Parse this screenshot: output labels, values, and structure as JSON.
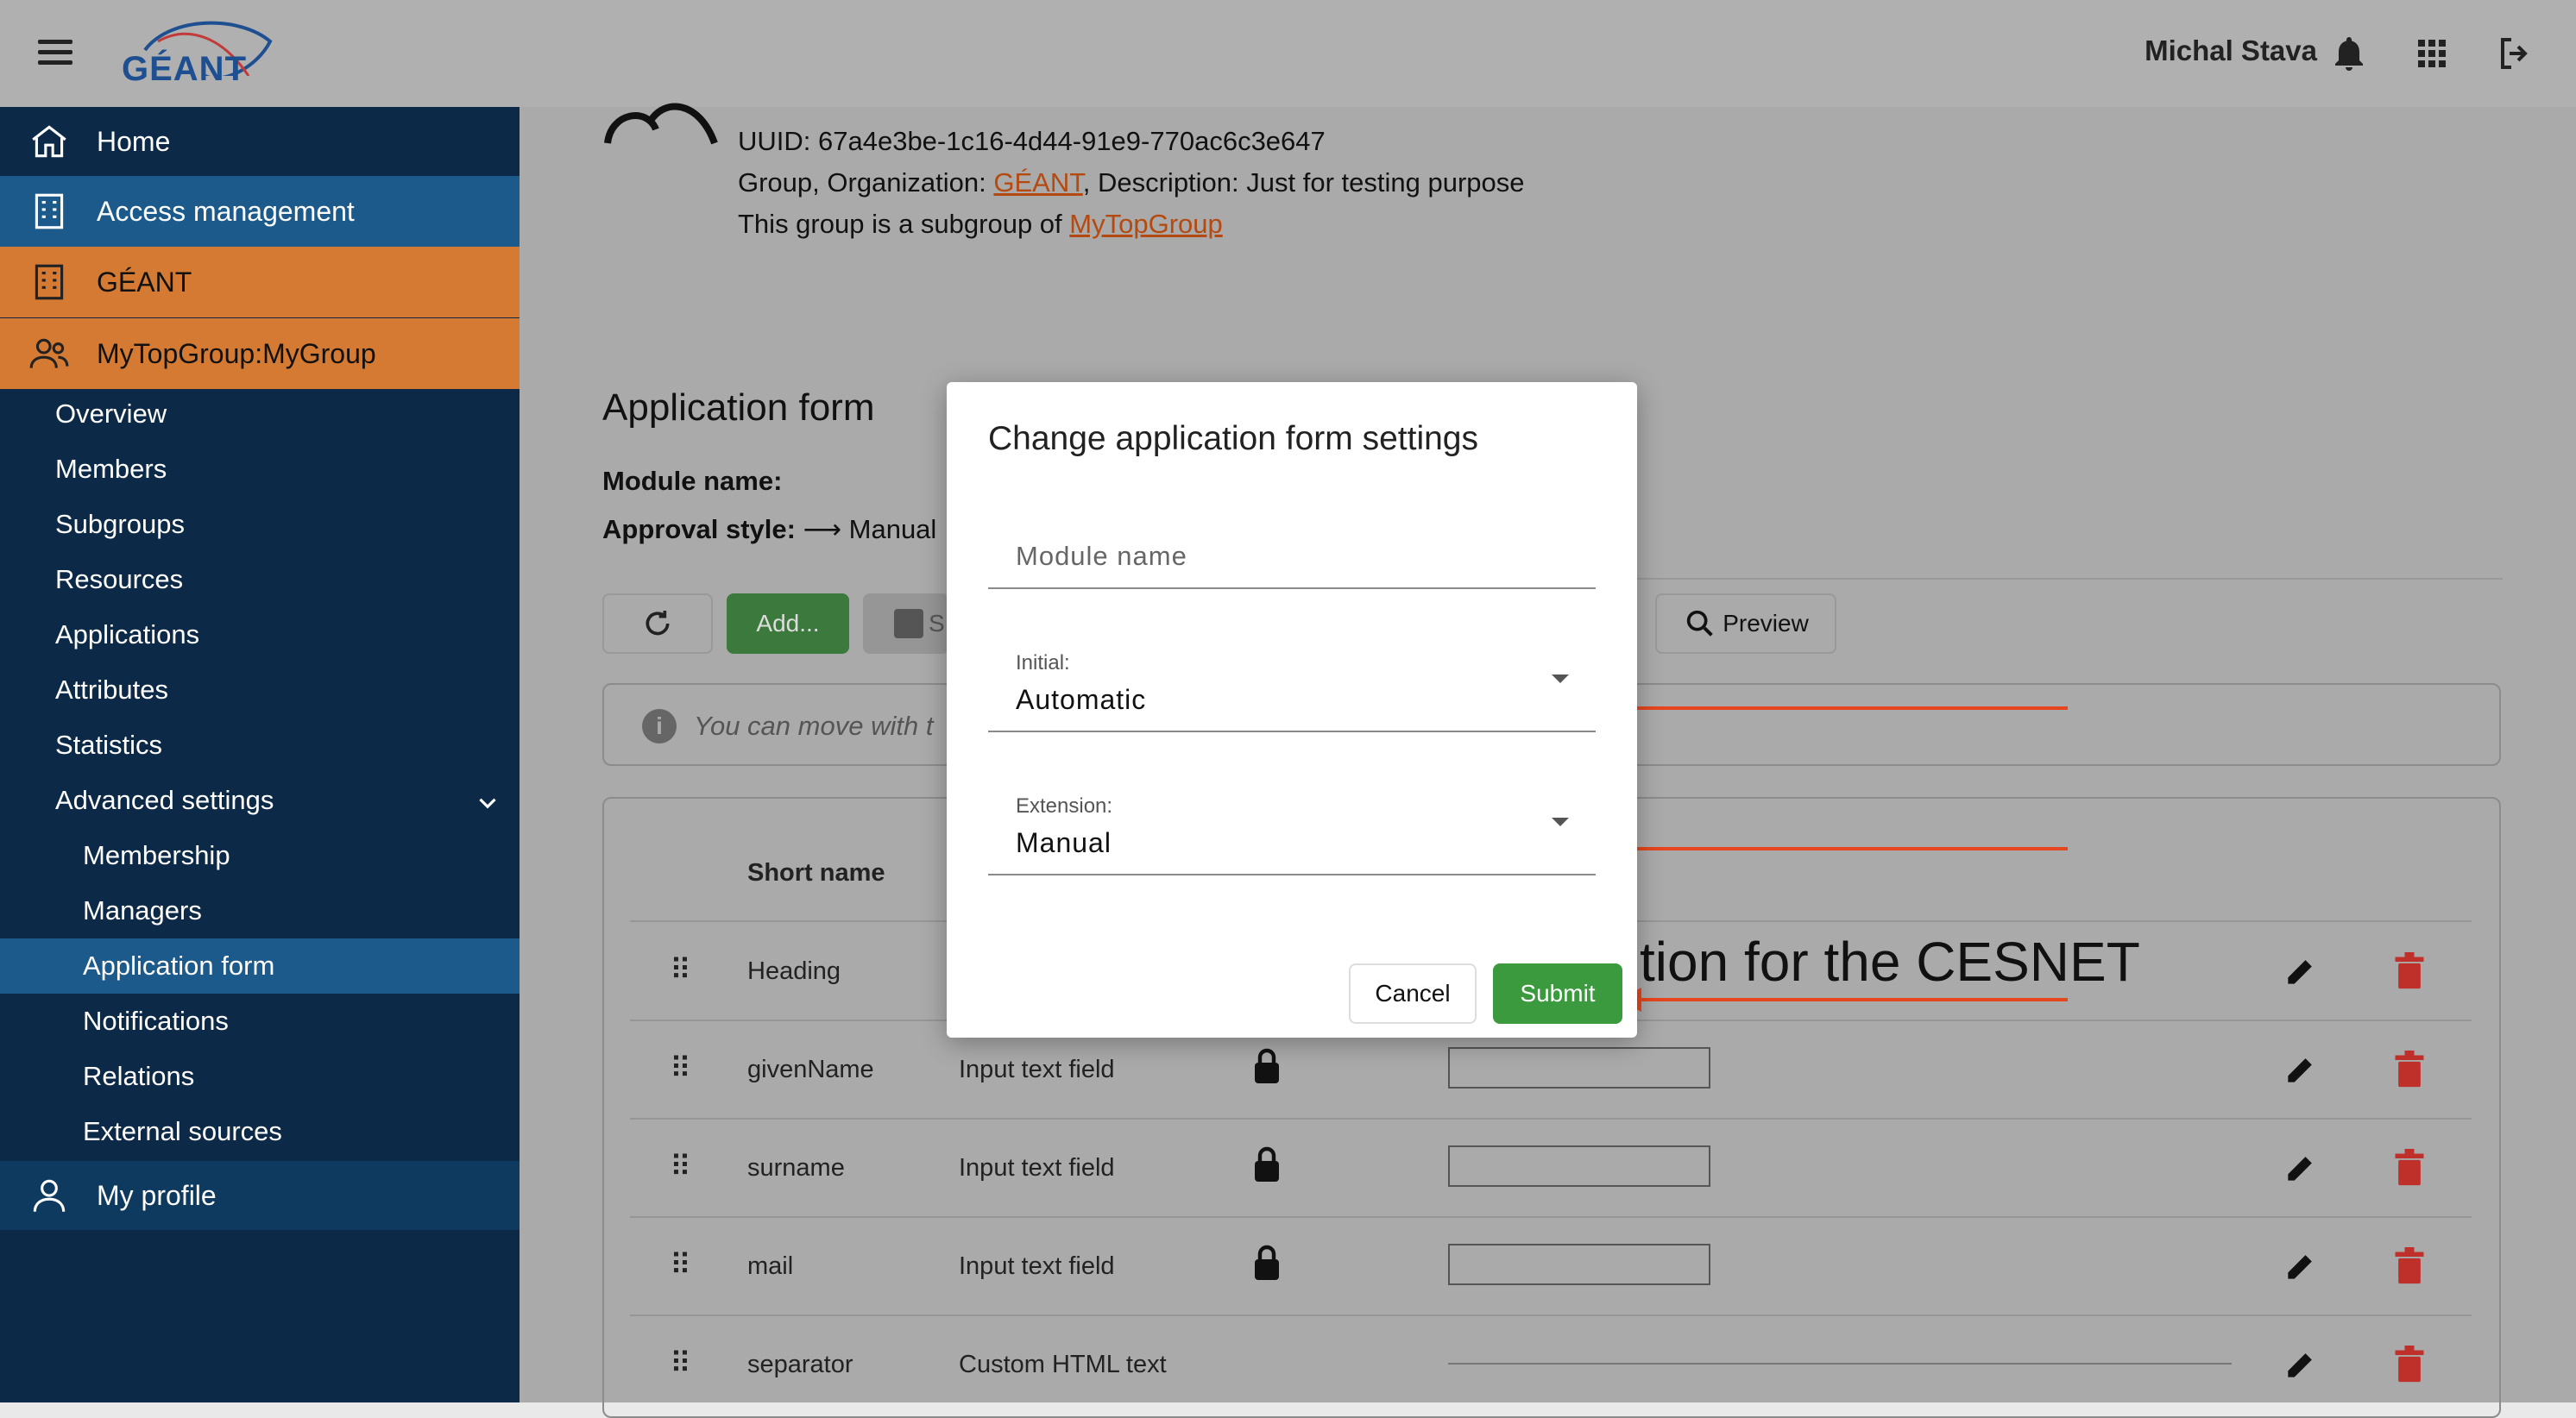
{
  "header": {
    "logo_text": "GÉANT",
    "user_name": "Michal Stava"
  },
  "sidebar": {
    "items": [
      {
        "label": "Home",
        "icon": "home-icon"
      },
      {
        "label": "Access management",
        "icon": "building-icon"
      },
      {
        "label": "GÉANT",
        "icon": "building-icon"
      },
      {
        "label": "MyTopGroup:MyGroup",
        "icon": "group-icon"
      }
    ],
    "group_menu": [
      "Overview",
      "Members",
      "Subgroups",
      "Resources",
      "Applications",
      "Attributes",
      "Statistics",
      "Advanced settings"
    ],
    "advanced_menu": [
      "Membership",
      "Managers",
      "Application form",
      "Notifications",
      "Relations",
      "External sources"
    ],
    "selected": "Application form",
    "profile": "My profile"
  },
  "group_info": {
    "uuid": "UUID: 67a4e3be-1c16-4d44-91e9-770ac6c3e647",
    "org_prefix": "Group, Organization: ",
    "org_link": "GÉANT",
    "desc": ", Description: Just for testing purpose",
    "subgroup_prefix": "This group is a subgroup of ",
    "subgroup_link": "MyTopGroup"
  },
  "form": {
    "title": "Application form",
    "module_label": "Module name:",
    "approval_label": "Approval style:",
    "approval_value": "Manual",
    "add_button": "Add...",
    "save_button_partial": "S",
    "preview_button": "Preview",
    "info_text": "You can move with t",
    "column_short_name": "Short name",
    "heading_partial": "tion for the CESNET",
    "rows": [
      {
        "short": "Heading",
        "type": ""
      },
      {
        "short": "givenName",
        "type": "Input text field"
      },
      {
        "short": "surname",
        "type": "Input text field"
      },
      {
        "short": "mail",
        "type": "Input text field"
      },
      {
        "short": "separator",
        "type": "Custom HTML text"
      }
    ]
  },
  "dialog": {
    "title": "Change application form settings",
    "module_placeholder": "Module name",
    "initial_label": "Initial:",
    "initial_value": "Automatic",
    "extension_label": "Extension:",
    "extension_value": "Manual",
    "cancel": "Cancel",
    "submit": "Submit"
  },
  "colors": {
    "sidebar_bg": "#0c2a47",
    "sidebar_selected": "#1d5a8c",
    "sidebar_orange": "#d47a33",
    "green": "#3b9a3d",
    "delete_red": "#c0302a",
    "annotation_red": "#e6461e"
  }
}
